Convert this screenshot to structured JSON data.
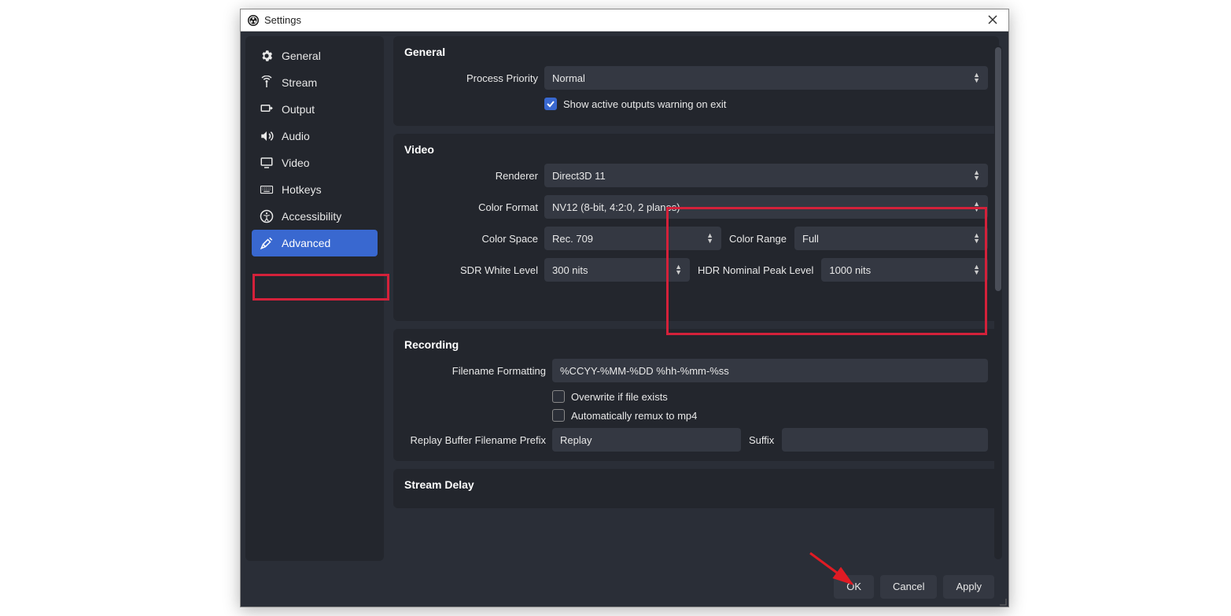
{
  "titlebar": {
    "title": "Settings"
  },
  "sidebar": {
    "items": [
      {
        "label": "General"
      },
      {
        "label": "Stream"
      },
      {
        "label": "Output"
      },
      {
        "label": "Audio"
      },
      {
        "label": "Video"
      },
      {
        "label": "Hotkeys"
      },
      {
        "label": "Accessibility"
      },
      {
        "label": "Advanced"
      }
    ]
  },
  "sections": {
    "general": {
      "title": "General",
      "process_priority_label": "Process Priority",
      "process_priority_value": "Normal",
      "show_active_outputs_label": "Show active outputs warning on exit",
      "show_active_outputs_checked": true
    },
    "video": {
      "title": "Video",
      "renderer_label": "Renderer",
      "renderer_value": "Direct3D 11",
      "color_format_label": "Color Format",
      "color_format_value": "NV12 (8-bit, 4:2:0, 2 planes)",
      "color_space_label": "Color Space",
      "color_space_value": "Rec. 709",
      "color_range_label": "Color Range",
      "color_range_value": "Full",
      "sdr_white_label": "SDR White Level",
      "sdr_white_value": "300 nits",
      "hdr_peak_label": "HDR Nominal Peak Level",
      "hdr_peak_value": "1000 nits"
    },
    "recording": {
      "title": "Recording",
      "filename_formatting_label": "Filename Formatting",
      "filename_formatting_value": "%CCYY-%MM-%DD %hh-%mm-%ss",
      "overwrite_label": "Overwrite if file exists",
      "overwrite_checked": false,
      "automux_label": "Automatically remux to mp4",
      "automux_checked": false,
      "replay_prefix_label": "Replay Buffer Filename Prefix",
      "replay_prefix_value": "Replay",
      "replay_suffix_label": "Suffix",
      "replay_suffix_value": ""
    },
    "stream_delay": {
      "title": "Stream Delay"
    }
  },
  "footer": {
    "ok": "OK",
    "cancel": "Cancel",
    "apply": "Apply"
  }
}
